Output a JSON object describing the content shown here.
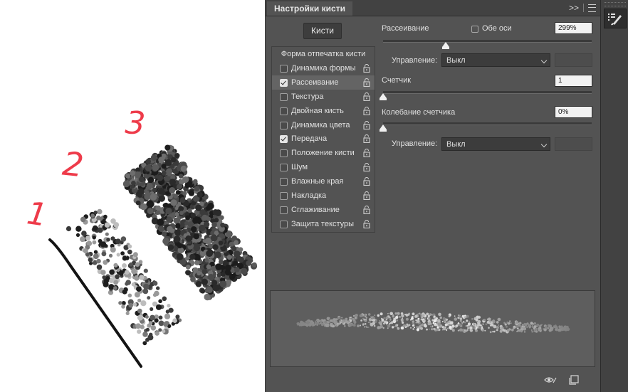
{
  "canvas": {
    "numbers": [
      "1",
      "2",
      "3"
    ],
    "colors": {
      "numbers": "#ee3b4a",
      "ink": "#1a1a1a"
    }
  },
  "panel": {
    "title": "Настройки кисти",
    "collapse_label": ">>",
    "brushes_button": "Кисти",
    "list_header": "Форма отпечатка кисти",
    "items": [
      {
        "label": "Динамика формы",
        "checked": false,
        "selected": false
      },
      {
        "label": "Рассеивание",
        "checked": true,
        "selected": true
      },
      {
        "label": "Текстура",
        "checked": false,
        "selected": false
      },
      {
        "label": "Двойная кисть",
        "checked": false,
        "selected": false
      },
      {
        "label": "Динамика цвета",
        "checked": false,
        "selected": false
      },
      {
        "label": "Передача",
        "checked": true,
        "selected": false
      },
      {
        "label": "Положение кисти",
        "checked": false,
        "selected": false
      },
      {
        "label": "Шум",
        "checked": false,
        "selected": false
      },
      {
        "label": "Влажные края",
        "checked": false,
        "selected": false
      },
      {
        "label": "Накладка",
        "checked": false,
        "selected": false
      },
      {
        "label": "Сглаживание",
        "checked": false,
        "selected": false
      },
      {
        "label": "Защита текстуры",
        "checked": false,
        "selected": false
      }
    ],
    "scatter": {
      "label": "Рассеивание",
      "both_axes_label": "Обе оси",
      "both_axes_checked": false,
      "value": "299%",
      "slider_fraction": 0.3
    },
    "control1": {
      "label": "Управление:",
      "value": "Выкл"
    },
    "count": {
      "label": "Счетчик",
      "value": "1",
      "slider_fraction": 0.0
    },
    "count_jitter": {
      "label": "Колебание счетчика",
      "value": "0%",
      "slider_fraction": 0.0
    },
    "control2": {
      "label": "Управление:",
      "value": "Выкл"
    }
  },
  "colors": {
    "panel_bg": "#535353",
    "tabbar_bg": "#424242",
    "field_bg": "#f2f2f2",
    "text": "#e0e0e0"
  }
}
